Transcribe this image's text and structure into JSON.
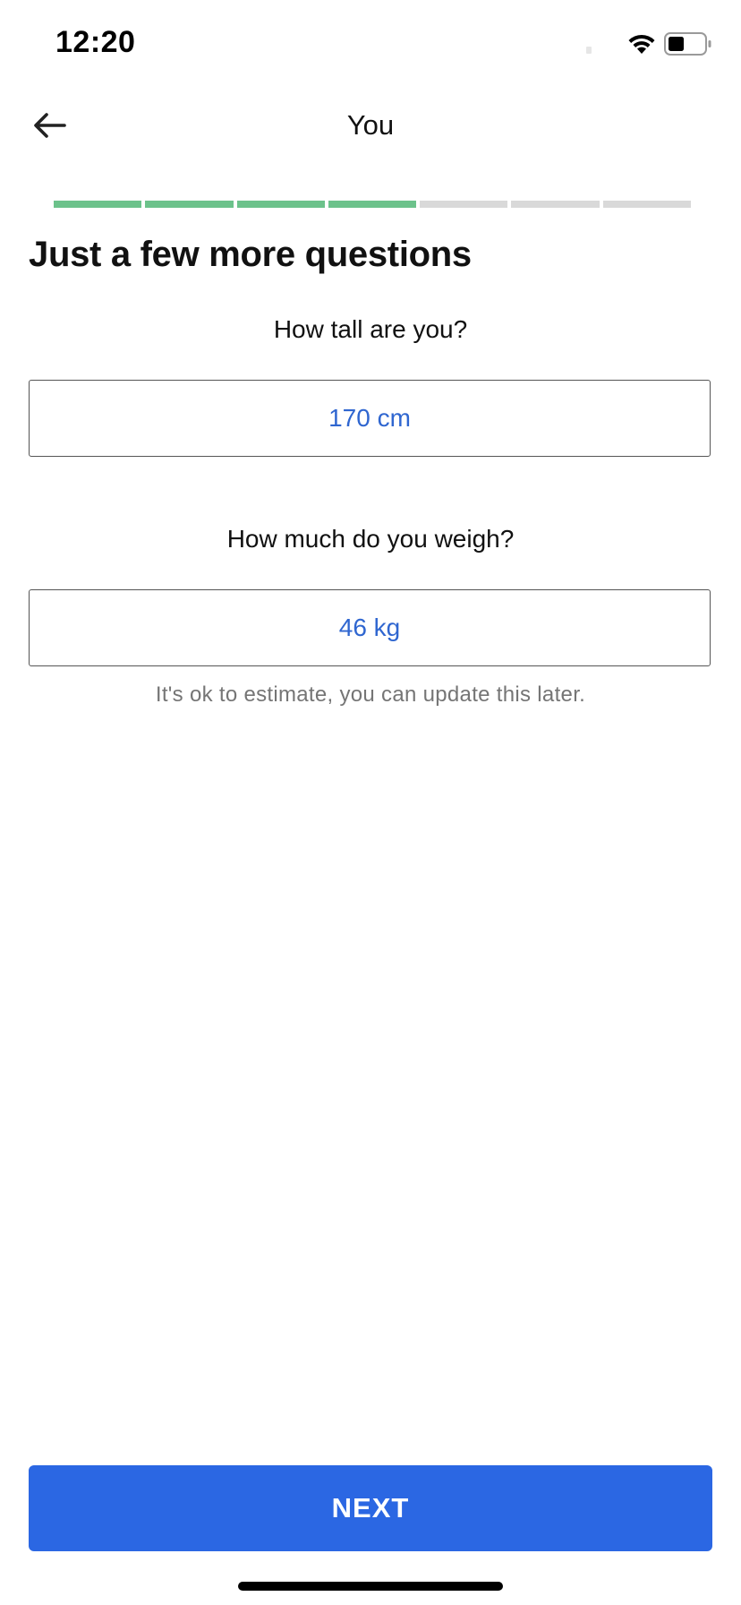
{
  "status_bar": {
    "time": "12:20"
  },
  "nav": {
    "title": "You",
    "back_icon": "arrow-left-icon"
  },
  "progress": {
    "total_steps": 7,
    "completed_steps": 4,
    "done_color": "#6cc28b",
    "todo_color": "#d9d9d9"
  },
  "main": {
    "heading": "Just a few more questions",
    "height_question": "How tall are you?",
    "height_value": "170 cm",
    "weight_question": "How much do you weigh?",
    "weight_value": "46 kg",
    "hint": "It's ok to estimate, you can update this later."
  },
  "footer": {
    "next_label": "NEXT",
    "button_color": "#2b67e3"
  },
  "colors": {
    "value_text": "#2f66d0"
  }
}
